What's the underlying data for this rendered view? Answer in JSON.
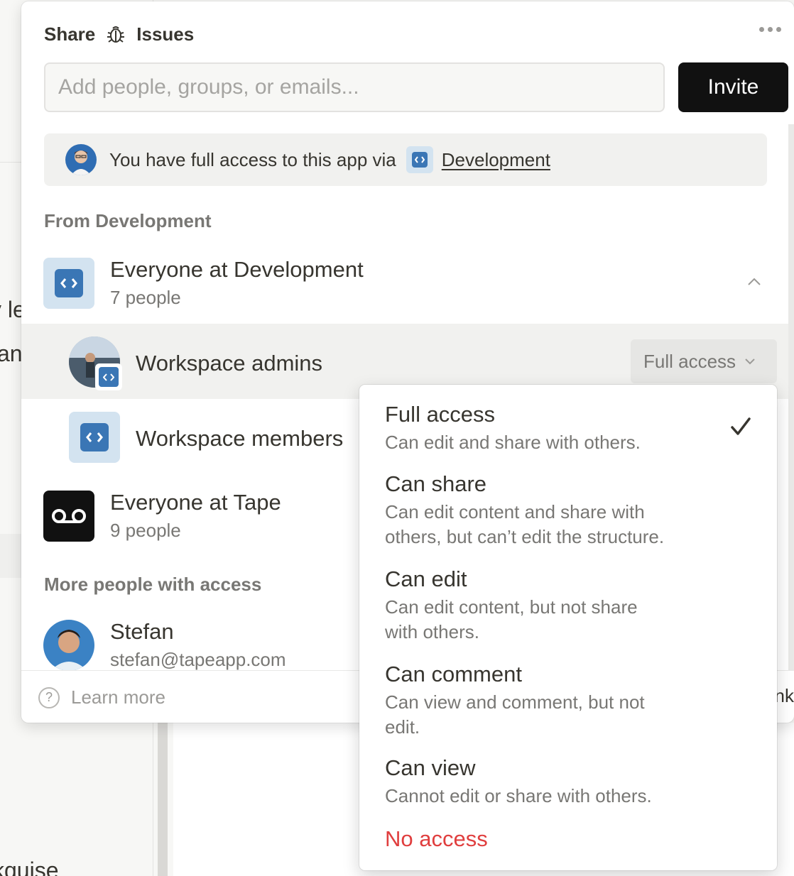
{
  "background": {
    "fragments": [
      "y le",
      "an",
      "kquise",
      "nk"
    ]
  },
  "share": {
    "tab_label": "Share",
    "page_title": "Issues",
    "more_icon": "more-horizontal-icon",
    "search": {
      "placeholder": "Add people, groups, or emails...",
      "value": ""
    },
    "invite_label": "Invite",
    "banner": {
      "text": "You have full access to this app via",
      "workspace": "Development"
    },
    "section_from": "From Development",
    "groups": [
      {
        "title": "Everyone at Development",
        "subtitle": "7 people"
      },
      {
        "title": "Workspace admins",
        "permission": "Full access"
      },
      {
        "title": "Workspace members"
      },
      {
        "title": "Everyone at Tape",
        "subtitle": "9 people"
      }
    ],
    "section_more": "More people with access",
    "people": [
      {
        "name": "Stefan",
        "email": "stefan@tapeapp.com"
      }
    ],
    "footer": {
      "learn_more": "Learn more"
    }
  },
  "permission_menu": {
    "items": [
      {
        "title": "Full access",
        "description": "Can edit and share with others.",
        "selected": true
      },
      {
        "title": "Can share",
        "description_lines": [
          "Can edit content and share with",
          "others, but can’t edit the structure."
        ]
      },
      {
        "title": "Can edit",
        "description_lines": [
          "Can edit content, but not share",
          "with others."
        ]
      },
      {
        "title": "Can comment",
        "description_lines": [
          "Can view and comment, but not",
          "edit."
        ]
      },
      {
        "title": "Can view",
        "description": "Cannot edit or share with others."
      }
    ],
    "danger_item": "No access"
  },
  "colors": {
    "accent_blue": "#3a76b5",
    "workspace_chip": "#d3e3f0",
    "danger": "#e03e3e",
    "invite_button": "#111111"
  }
}
